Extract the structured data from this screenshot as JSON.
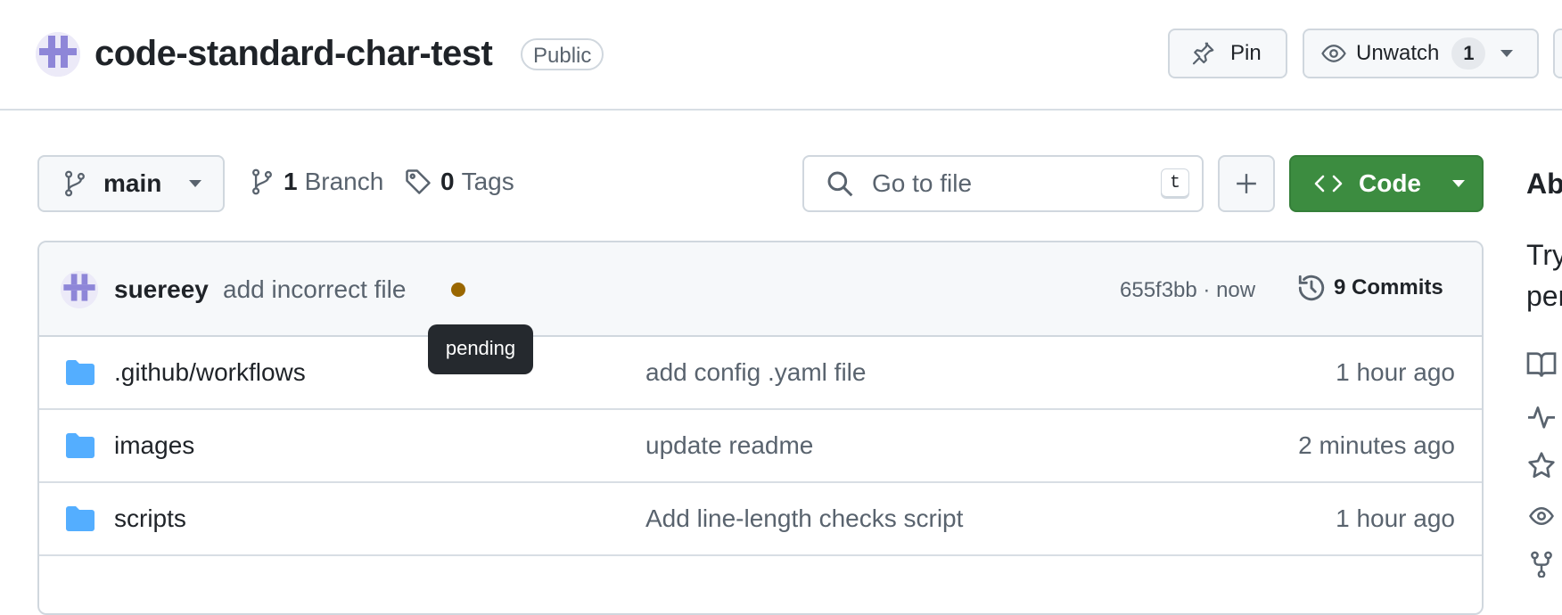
{
  "repo": {
    "name": "code-standard-char-test",
    "visibility": "Public"
  },
  "header_actions": {
    "pin_label": "Pin",
    "unwatch_label": "Unwatch",
    "watch_count": "1"
  },
  "toolbar": {
    "branch_name": "main",
    "branch_count": "1",
    "branch_label": "Branch",
    "tag_count": "0",
    "tag_label": "Tags",
    "search_placeholder": "Go to file",
    "search_shortcut": "t",
    "code_label": "Code"
  },
  "latest_commit": {
    "author": "suereey",
    "message": "add incorrect file",
    "status_tooltip": "pending",
    "status_color": "#9a6700",
    "hash_time": "655f3bb · now",
    "commits_label": "9 Commits"
  },
  "files": [
    {
      "name": ".github/workflows",
      "message": "add config .yaml file",
      "time": "1 hour ago"
    },
    {
      "name": "images",
      "message": "update readme",
      "time": "2 minutes ago"
    },
    {
      "name": "scripts",
      "message": "Add line-length checks script",
      "time": "1 hour ago"
    }
  ],
  "about": {
    "heading": "Ab",
    "desc_line1": "Try",
    "desc_line2": "per"
  },
  "colors": {
    "accent_green": "#3c8c40",
    "folder_blue": "#54aeff",
    "tooltip_bg": "#25292e"
  }
}
